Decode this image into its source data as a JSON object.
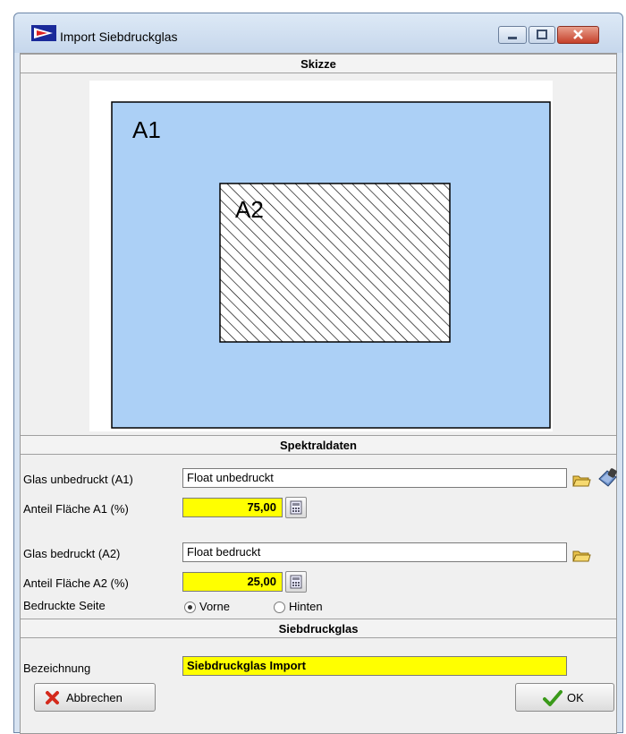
{
  "window": {
    "title": "Import Siebdruckglas"
  },
  "sections": {
    "sketch": "Skizze",
    "spectral": "Spektraldaten",
    "screenprint": "Siebdruckglas"
  },
  "sketch": {
    "label_a1": "A1",
    "label_a2": "A2",
    "colors": {
      "outer_fill": "#acd0f6",
      "inner_fill": "#ffffff",
      "hatch": "#000000"
    }
  },
  "spectral": {
    "glass_unprinted_label": "Glas unbedruckt (A1)",
    "glass_unprinted_value": "Float unbedruckt",
    "area_a1_label": "Anteil Fläche A1 (%)",
    "area_a1_value": "75,00",
    "glass_printed_label": "Glas bedruckt (A2)",
    "glass_printed_value": "Float bedruckt",
    "area_a2_label": "Anteil Fläche A2 (%)",
    "area_a2_value": "25,00",
    "printed_side_label": "Bedruckte Seite",
    "side_options": [
      "Vorne",
      "Hinten"
    ],
    "side_selected": "Vorne"
  },
  "screenprint": {
    "name_label": "Bezeichnung",
    "name_value": "Siebdruckglas Import"
  },
  "buttons": {
    "cancel": "Abbrechen",
    "ok": "OK"
  },
  "colors": {
    "highlight": "#ffff00",
    "sketch_blue": "#acd0f6",
    "cancel_x": "#d42a1c",
    "ok_check": "#3a9a1a"
  }
}
